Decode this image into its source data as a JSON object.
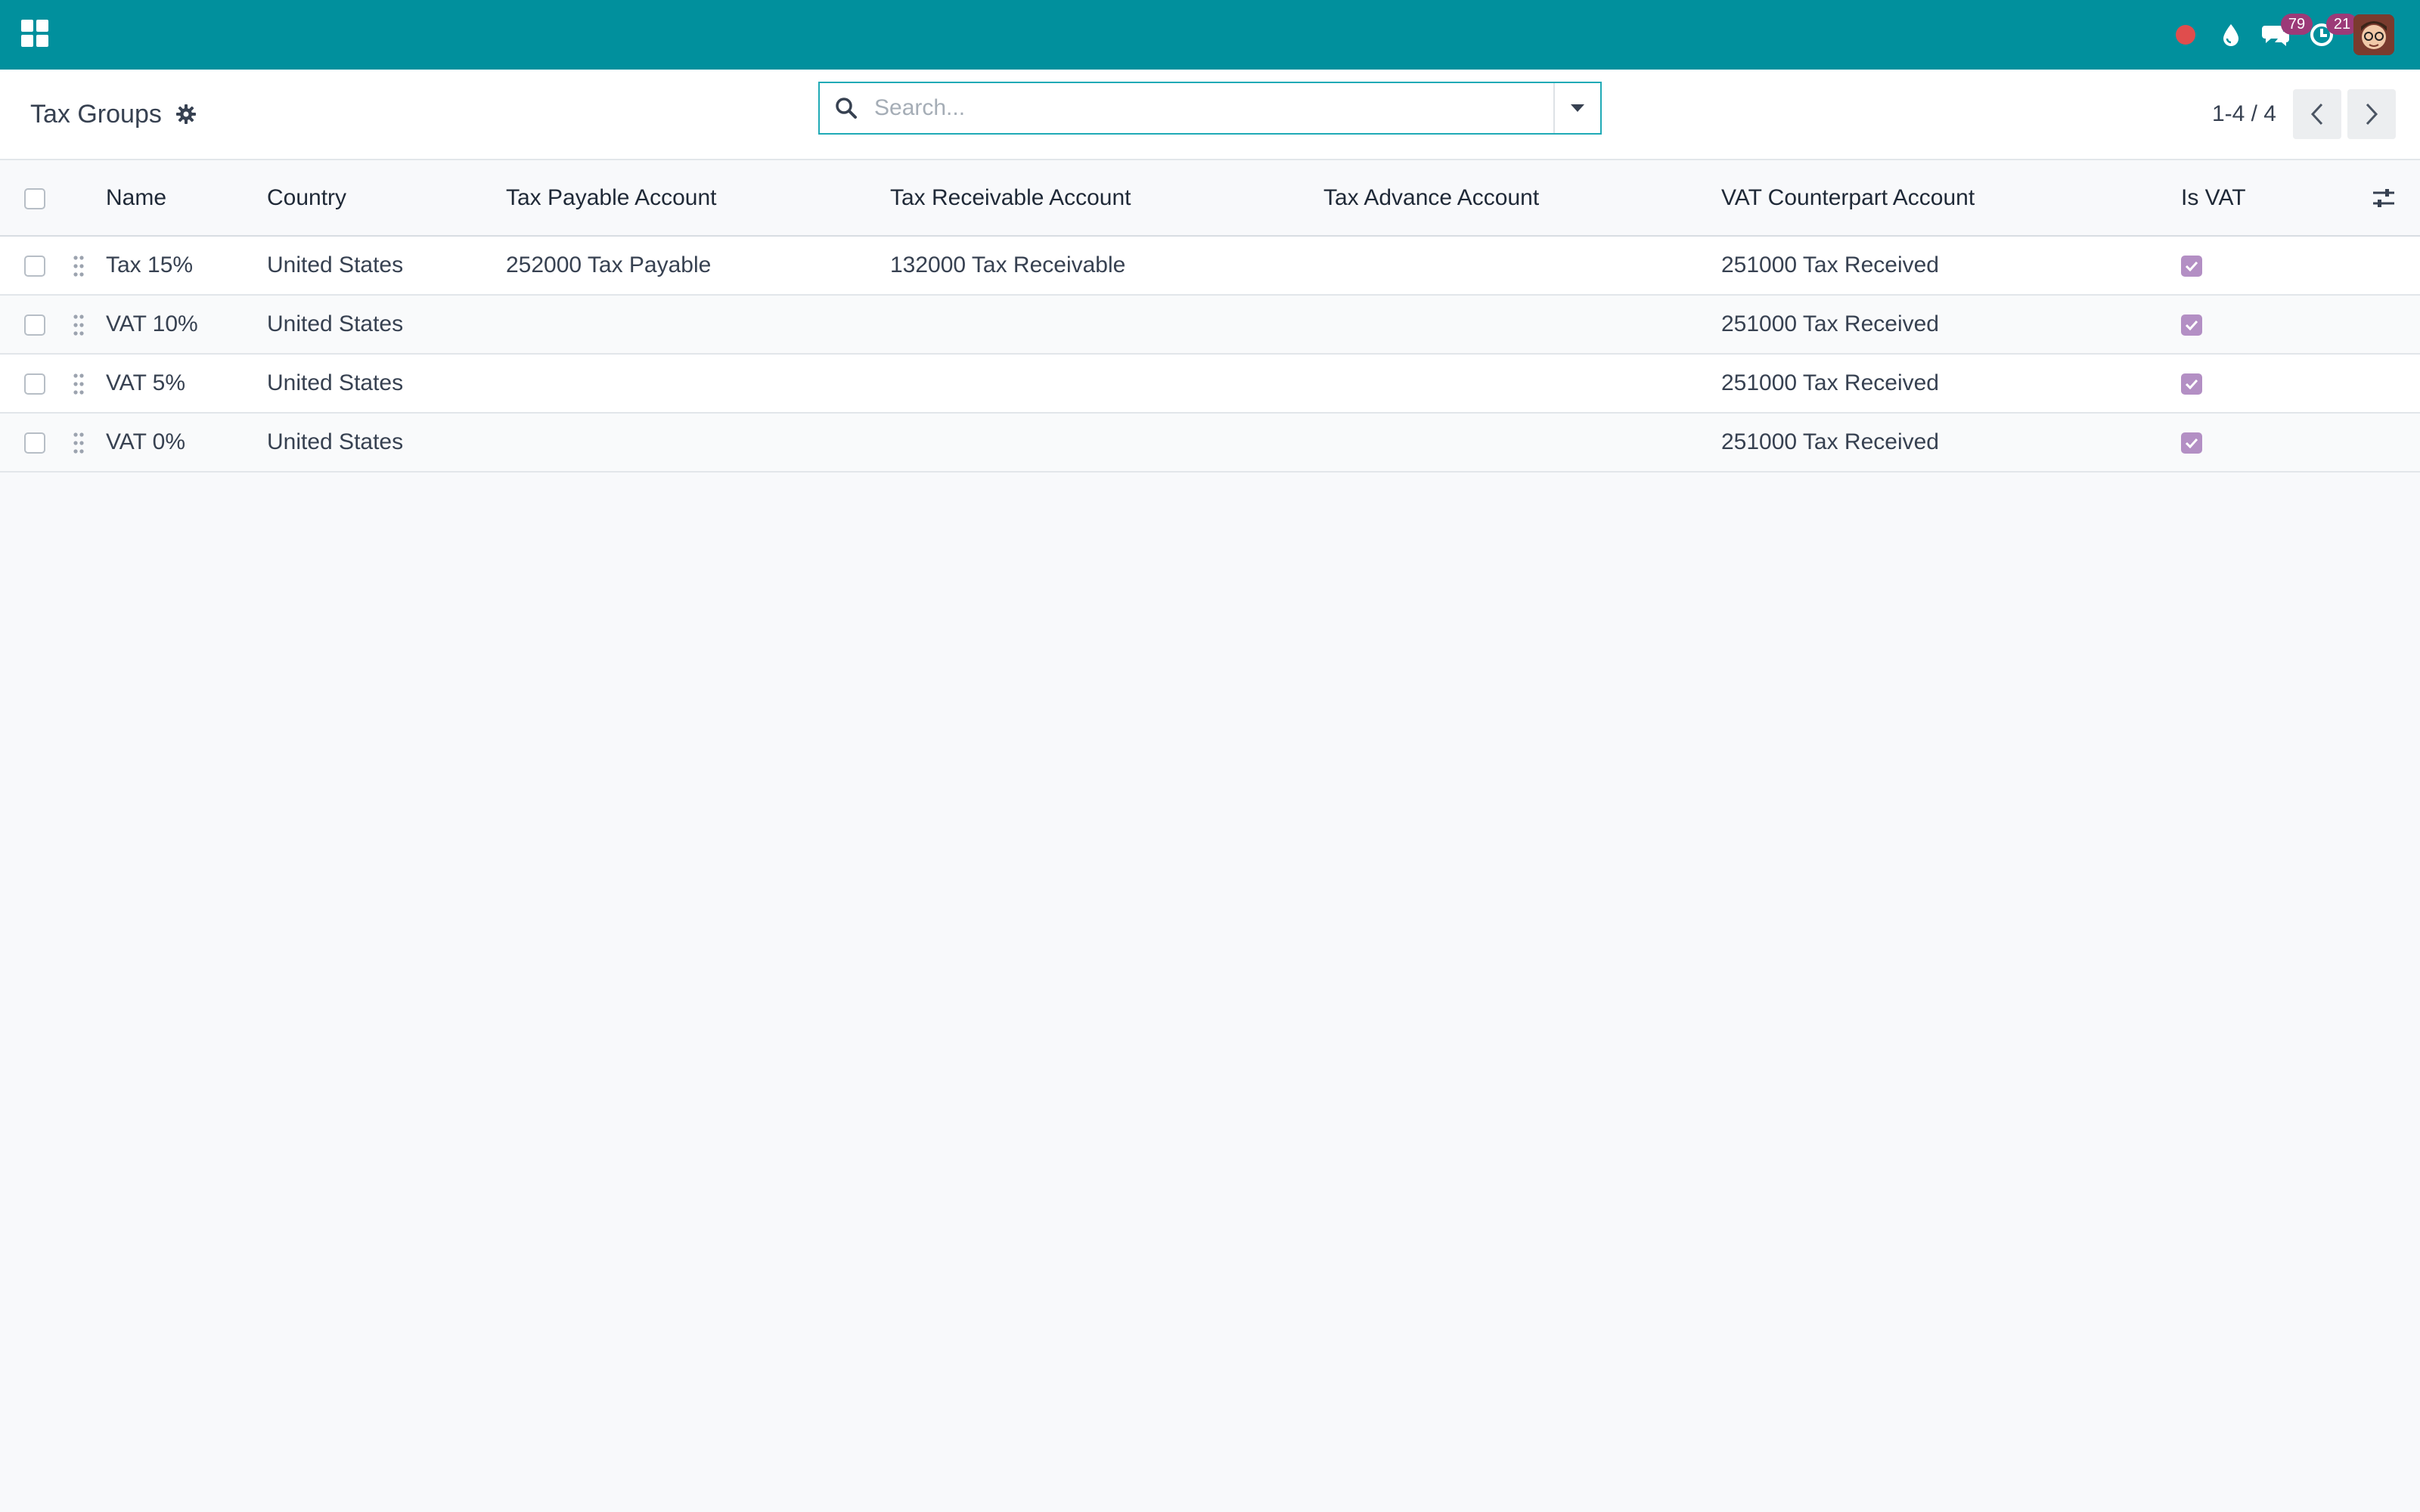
{
  "navbar": {
    "messages_count": "79",
    "activities_count": "21",
    "colors": {
      "bg": "#01909d",
      "badge": "#9c3a78",
      "record": "#e04d4d"
    }
  },
  "control_panel": {
    "title": "Tax Groups",
    "search_placeholder": "Search...",
    "pager": "1-4 / 4"
  },
  "table": {
    "columns": [
      "Name",
      "Country",
      "Tax Payable Account",
      "Tax Receivable Account",
      "Tax Advance Account",
      "VAT Counterpart Account",
      "Is VAT"
    ],
    "rows": [
      {
        "name": "Tax 15%",
        "country": "United States",
        "payable": "252000 Tax Payable",
        "receivable": "132000 Tax Receivable",
        "advance": "",
        "counterpart": "251000 Tax Received",
        "is_vat": true
      },
      {
        "name": "VAT 10%",
        "country": "United States",
        "payable": "",
        "receivable": "",
        "advance": "",
        "counterpart": "251000 Tax Received",
        "is_vat": true
      },
      {
        "name": "VAT 5%",
        "country": "United States",
        "payable": "",
        "receivable": "",
        "advance": "",
        "counterpart": "251000 Tax Received",
        "is_vat": true
      },
      {
        "name": "VAT 0%",
        "country": "United States",
        "payable": "",
        "receivable": "",
        "advance": "",
        "counterpart": "251000 Tax Received",
        "is_vat": true
      }
    ]
  }
}
